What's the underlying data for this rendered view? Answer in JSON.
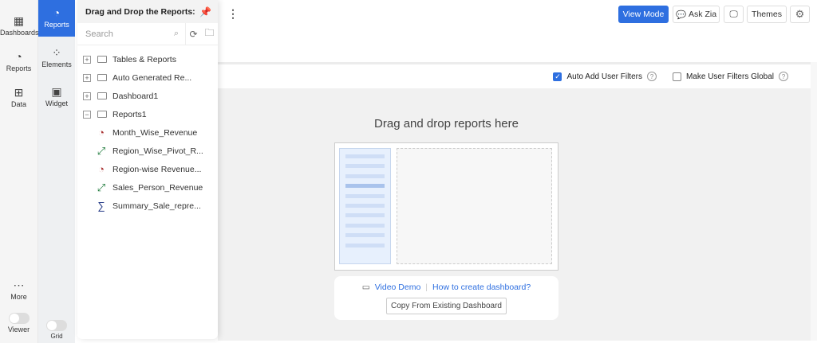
{
  "nav": {
    "items": [
      {
        "label": "Dashboards",
        "icon": "grid-icon"
      },
      {
        "label": "Reports",
        "icon": "pie-chart-icon"
      },
      {
        "label": "Data",
        "icon": "table-icon"
      }
    ],
    "more": "More",
    "viewer": "Viewer"
  },
  "subnav": {
    "items": [
      {
        "label": "Reports",
        "icon": "pie-chart-icon",
        "active": true
      },
      {
        "label": "Elements",
        "icon": "elements-icon"
      },
      {
        "label": "Widget",
        "icon": "widget-icon"
      }
    ],
    "grid": "Grid"
  },
  "panel": {
    "title": "Drag and Drop the Reports:",
    "search_placeholder": "Search",
    "folders": [
      {
        "label": "Tables & Reports",
        "expanded": false
      },
      {
        "label": "Auto Generated Re...",
        "expanded": false
      },
      {
        "label": "Dashboard1",
        "expanded": false
      },
      {
        "label": "Reports1",
        "expanded": true
      }
    ],
    "reports": [
      {
        "label": "Month_Wise_Revenue",
        "icon": "pie-chart-icon"
      },
      {
        "label": "Region_Wise_Pivot_R...",
        "icon": "pivot-icon"
      },
      {
        "label": "Region-wise Revenue...",
        "icon": "pie-chart-icon"
      },
      {
        "label": "Sales_Person_Revenue",
        "icon": "pivot-icon"
      },
      {
        "label": "Summary_Sale_repre...",
        "icon": "summary-icon"
      }
    ]
  },
  "toolbar": {
    "view_mode": "View Mode",
    "ask_zia": "Ask Zia",
    "themes": "Themes"
  },
  "filters": {
    "auto_add": "Auto Add User Filters",
    "auto_add_checked": true,
    "make_global": "Make User Filters Global",
    "make_global_checked": false
  },
  "canvas": {
    "title": "Drag and drop reports here",
    "video_demo": "Video Demo",
    "how_to": "How to create dashboard?",
    "copy": "Copy From Existing Dashboard"
  },
  "colors": {
    "accent": "#2e6fe0"
  }
}
